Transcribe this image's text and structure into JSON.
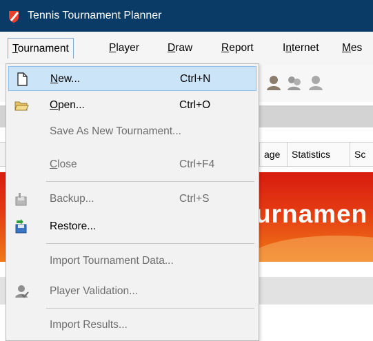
{
  "window": {
    "title": "Tennis Tournament Planner"
  },
  "menubar": {
    "items": [
      {
        "pre": "",
        "ul": "T",
        "post": "ournament"
      },
      {
        "pre": "",
        "ul": "P",
        "post": "layer"
      },
      {
        "pre": "",
        "ul": "D",
        "post": "raw"
      },
      {
        "pre": "",
        "ul": "R",
        "post": "eport"
      },
      {
        "pre": "I",
        "ul": "n",
        "post": "ternet"
      },
      {
        "pre": "",
        "ul": "M",
        "post": "es"
      }
    ]
  },
  "background": {
    "tabs": [
      "age",
      "Statistics",
      "Sc"
    ],
    "banner_text": "urnamen"
  },
  "dropdown": {
    "items": [
      {
        "pre": "",
        "ul": "N",
        "post": "ew...",
        "shortcut": "Ctrl+N",
        "icon": "new-document-icon",
        "disabled": false,
        "highlight": true
      },
      {
        "pre": "",
        "ul": "O",
        "post": "pen...",
        "shortcut": "Ctrl+O",
        "icon": "open-folder-icon",
        "disabled": false,
        "highlight": false
      },
      {
        "pre": "Save As New Tournament...",
        "ul": "",
        "post": "",
        "shortcut": "",
        "icon": "",
        "disabled": true,
        "highlight": false
      },
      {
        "pre": "",
        "ul": "C",
        "post": "lose",
        "shortcut": "Ctrl+F4",
        "icon": "",
        "disabled": true,
        "highlight": false
      },
      {
        "pre": "Backup...",
        "ul": "",
        "post": "",
        "shortcut": "Ctrl+S",
        "icon": "backup-icon",
        "disabled": true,
        "highlight": false
      },
      {
        "pre": "Restore...",
        "ul": "",
        "post": "",
        "shortcut": "",
        "icon": "restore-icon",
        "disabled": false,
        "highlight": false
      },
      {
        "pre": "Import Tournament Data...",
        "ul": "",
        "post": "",
        "shortcut": "",
        "icon": "",
        "disabled": true,
        "highlight": false
      },
      {
        "pre": "Player Validation...",
        "ul": "",
        "post": "",
        "shortcut": "",
        "icon": "player-validation-icon",
        "disabled": true,
        "highlight": false
      },
      {
        "pre": "Import Results...",
        "ul": "",
        "post": "",
        "shortcut": "",
        "icon": "",
        "disabled": true,
        "highlight": false
      }
    ]
  },
  "colors": {
    "titlebar": "#0a3a66",
    "highlight": "#cce4f7",
    "disabled_text": "#6d6d6d",
    "banner_red": "#d81c10"
  }
}
